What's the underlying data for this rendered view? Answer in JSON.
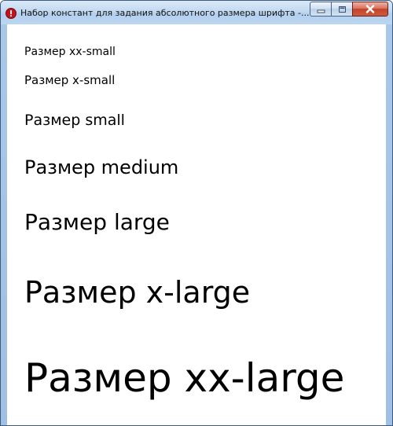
{
  "window": {
    "title": "Набор констант для задания абсолютного размера шрифта -...",
    "icons": {
      "app": "error-icon",
      "minimize": "minimize-icon",
      "maximize": "maximize-icon",
      "close": "close-icon"
    }
  },
  "content": {
    "lines": [
      "Размер xx-small",
      "Размер x-small",
      "Размер small",
      "Размер medium",
      "Размер large",
      "Размер x-large",
      "Размер xx-large"
    ]
  },
  "colors": {
    "titlebar": "#c2d9f1",
    "close_button": "#c1442a",
    "app_icon": "#c8101a",
    "text": "#000000"
  }
}
